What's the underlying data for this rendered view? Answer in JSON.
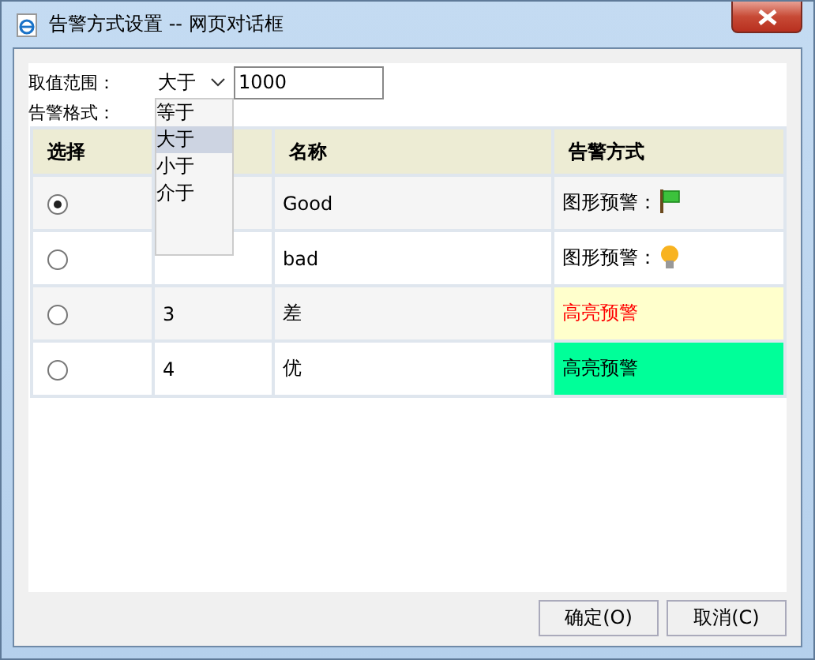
{
  "window": {
    "title": "告警方式设置 -- 网页对话框"
  },
  "range": {
    "label": "取值范围：",
    "operator": "大于",
    "value": "1000",
    "options": [
      {
        "label": "等于",
        "selected": false
      },
      {
        "label": "大于",
        "selected": true
      },
      {
        "label": "小于",
        "selected": false
      },
      {
        "label": "介于",
        "selected": false
      }
    ]
  },
  "format_label": "告警格式：",
  "table": {
    "columns": [
      {
        "label": "选择"
      },
      {},
      {
        "label": "名称"
      },
      {
        "label": "告警方式"
      }
    ],
    "rows": [
      {
        "selected": true,
        "name": "Good",
        "alert": {
          "kind": "flag",
          "text": "图形预警："
        }
      },
      {
        "selected": false,
        "name": "bad",
        "alert": {
          "kind": "bulb",
          "text": "图形预警："
        }
      },
      {
        "selected": false,
        "number": "3",
        "name": "差",
        "alert": {
          "kind": "alarm",
          "text": "高亮预警",
          "color": "#ffffcc"
        }
      },
      {
        "selected": false,
        "number": "4",
        "name": "优",
        "alert": {
          "kind": "highlight",
          "text": "高亮预警",
          "color": "#00ff99"
        }
      }
    ]
  },
  "buttons": [
    "确定(O)",
    "取消(C)"
  ]
}
